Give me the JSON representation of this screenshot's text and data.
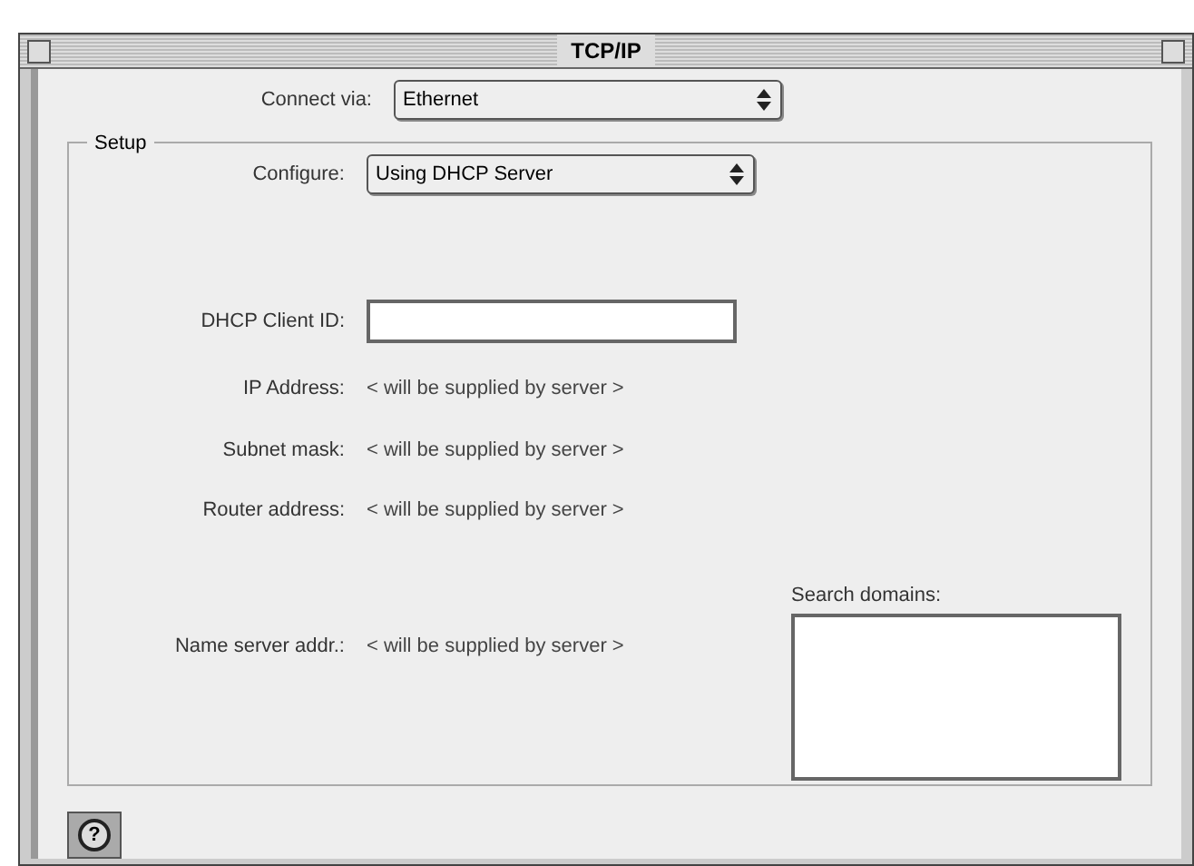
{
  "window": {
    "title": "TCP/IP"
  },
  "connect_via": {
    "label": "Connect via:",
    "value": "Ethernet"
  },
  "setup": {
    "legend": "Setup",
    "configure": {
      "label": "Configure:",
      "value": "Using DHCP Server"
    },
    "dhcp_client_id": {
      "label": "DHCP Client ID:"
    },
    "fields": [
      {
        "label": "IP Address:",
        "value": "< will be supplied by server >"
      },
      {
        "label": "Subnet mask:",
        "value": "< will be supplied by server >"
      },
      {
        "label": "Router address:",
        "value": "< will be supplied by server >"
      }
    ],
    "name_server": {
      "label": "Name server addr.:",
      "value": "< will be supplied by server >"
    },
    "search_domains": {
      "label": "Search domains:"
    }
  },
  "help_button": {
    "label": "?"
  }
}
